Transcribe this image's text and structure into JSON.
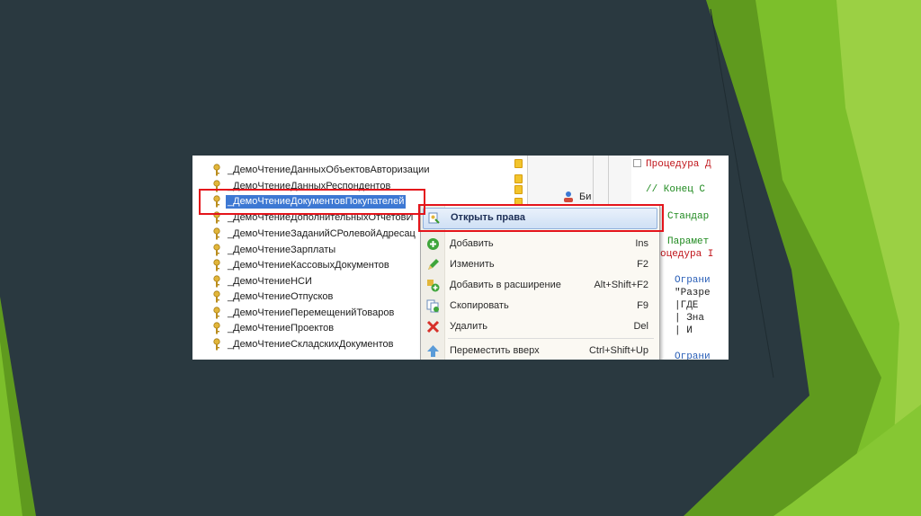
{
  "theme": {
    "background": "#2a3940",
    "accent_green": "#7cbf2b",
    "highlight_red": "#e4141b",
    "selection_blue": "#3d78d3"
  },
  "tree": {
    "items": [
      {
        "label": "_ДемоЧтениеДанныхОбъектовАвторизации"
      },
      {
        "label": "_ДемоЧтениеДанныхРеспондентов"
      },
      {
        "label": "_ДемоЧтениеДокументовПокупателей",
        "selected": true
      },
      {
        "label": "_ДемоЧтениеДополнительныхОтчетовИ"
      },
      {
        "label": "_ДемоЧтениеЗаданийСРолевойАдресац"
      },
      {
        "label": "_ДемоЧтениеЗарплаты"
      },
      {
        "label": "_ДемоЧтениеКассовыхДокументов"
      },
      {
        "label": "_ДемоЧтениеНСИ"
      },
      {
        "label": "_ДемоЧтениеОтпусков"
      },
      {
        "label": "_ДемоЧтениеПеремещенийТоваров"
      },
      {
        "label": "_ДемоЧтениеПроектов"
      },
      {
        "label": "_ДемоЧтениеСкладскихДокументов"
      }
    ]
  },
  "middle": {
    "bi_text": "Би"
  },
  "code": {
    "lines": [
      {
        "text": "Процедура Д",
        "color": "#c0141a"
      },
      {
        "text": "// Конец С",
        "color": "#1f8a1f"
      },
      {
        "text": "Стандар",
        "color": "#1f8a1f"
      },
      {
        "text": "Парамет",
        "color": "#1f8a1f"
      },
      {
        "text": "оцедура I",
        "color": "#c0141a"
      },
      {
        "text": "Ограни",
        "color": "#2a5fb7"
      },
      {
        "text": "\"Разре",
        "color": "#222222"
      },
      {
        "text": "|ГДЕ",
        "color": "#222222"
      },
      {
        "text": "|   Зна",
        "color": "#222222"
      },
      {
        "text": "|   И ",
        "color": "#222222"
      },
      {
        "text": "Ограни",
        "color": "#2a5fb7"
      }
    ]
  },
  "menu": {
    "items": [
      {
        "label": "Открыть права",
        "shortcut": "",
        "icon": "open-rights-icon",
        "highlight": true
      },
      {
        "label": "Добавить",
        "shortcut": "Ins",
        "icon": "add-icon"
      },
      {
        "label": "Изменить",
        "shortcut": "F2",
        "icon": "edit-icon"
      },
      {
        "label": "Добавить в расширение",
        "shortcut": "Alt+Shift+F2",
        "icon": "add-to-extension-icon"
      },
      {
        "label": "Скопировать",
        "shortcut": "F9",
        "icon": "copy-icon"
      },
      {
        "label": "Удалить",
        "shortcut": "Del",
        "icon": "delete-icon"
      },
      {
        "label": "Переместить вверх",
        "shortcut": "Ctrl+Shift+Up",
        "icon": "move-up-icon"
      }
    ]
  }
}
